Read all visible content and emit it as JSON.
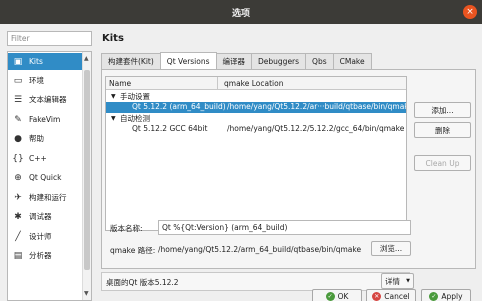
{
  "window": {
    "title": "选项",
    "close_glyph": "×"
  },
  "filter": {
    "placeholder": "Filter"
  },
  "sidebar": {
    "items": [
      {
        "label": "Kits",
        "icon": "kits-icon",
        "glyph": "▣",
        "selected": true
      },
      {
        "label": "环境",
        "icon": "monitor-icon",
        "glyph": "▭"
      },
      {
        "label": "文本编辑器",
        "icon": "text-editor-icon",
        "glyph": "☰"
      },
      {
        "label": "FakeVim",
        "icon": "fakevim-icon",
        "glyph": "✎"
      },
      {
        "label": "帮助",
        "icon": "help-icon",
        "glyph": "●"
      },
      {
        "label": "C++",
        "icon": "cpp-icon",
        "glyph": "{}"
      },
      {
        "label": "Qt Quick",
        "icon": "qtquick-icon",
        "glyph": "⊕"
      },
      {
        "label": "构建和运行",
        "icon": "build-run-icon",
        "glyph": "✈"
      },
      {
        "label": "调试器",
        "icon": "debugger-icon",
        "glyph": "✱"
      },
      {
        "label": "设计师",
        "icon": "designer-icon",
        "glyph": "╱"
      },
      {
        "label": "分析器",
        "icon": "analyzer-icon",
        "glyph": "▤"
      }
    ]
  },
  "main": {
    "title": "Kits",
    "tabs": [
      {
        "label": "构建套件(Kit)"
      },
      {
        "label": "Qt Versions",
        "active": true
      },
      {
        "label": "编译器"
      },
      {
        "label": "Debuggers"
      },
      {
        "label": "Qbs"
      },
      {
        "label": "CMake"
      }
    ]
  },
  "tree": {
    "headers": {
      "name": "Name",
      "location": "qmake Location"
    },
    "rows": [
      {
        "name": "手动设置",
        "location": "",
        "level": 0,
        "expander": "▼"
      },
      {
        "name": "Qt 5.12.2 (arm_64_build)",
        "location": "/home/yang/Qt5.12.2/ar···build/qtbase/bin/qmake",
        "level": 1,
        "selected": true
      },
      {
        "name": "自动检测",
        "location": "",
        "level": 0,
        "expander": "▼"
      },
      {
        "name": "Qt 5.12.2 GCC 64bit",
        "location": "/home/yang/Qt5.12.2/5.12.2/gcc_64/bin/qmake",
        "level": 1
      }
    ]
  },
  "buttons": {
    "add": "添加...",
    "remove": "删除",
    "cleanup": "Clean Up"
  },
  "details": {
    "version_name_label": "版本名称:",
    "version_name_value": "Qt %{Qt:Version} (arm_64_build)",
    "qmake_path_label": "qmake 路径:",
    "qmake_path_value": "/home/yang/Qt5.12.2/arm_64_build/qtbase/bin/qmake",
    "browse": "浏览..."
  },
  "info": {
    "text": "桌面的Qt 版本5.12.2",
    "details_button": "详情"
  },
  "footer": {
    "ok": "OK",
    "cancel": "Cancel",
    "apply": "Apply"
  },
  "colors": {
    "accent": "#308cc6",
    "titlebar": "#3c3b37",
    "close": "#e95420"
  }
}
